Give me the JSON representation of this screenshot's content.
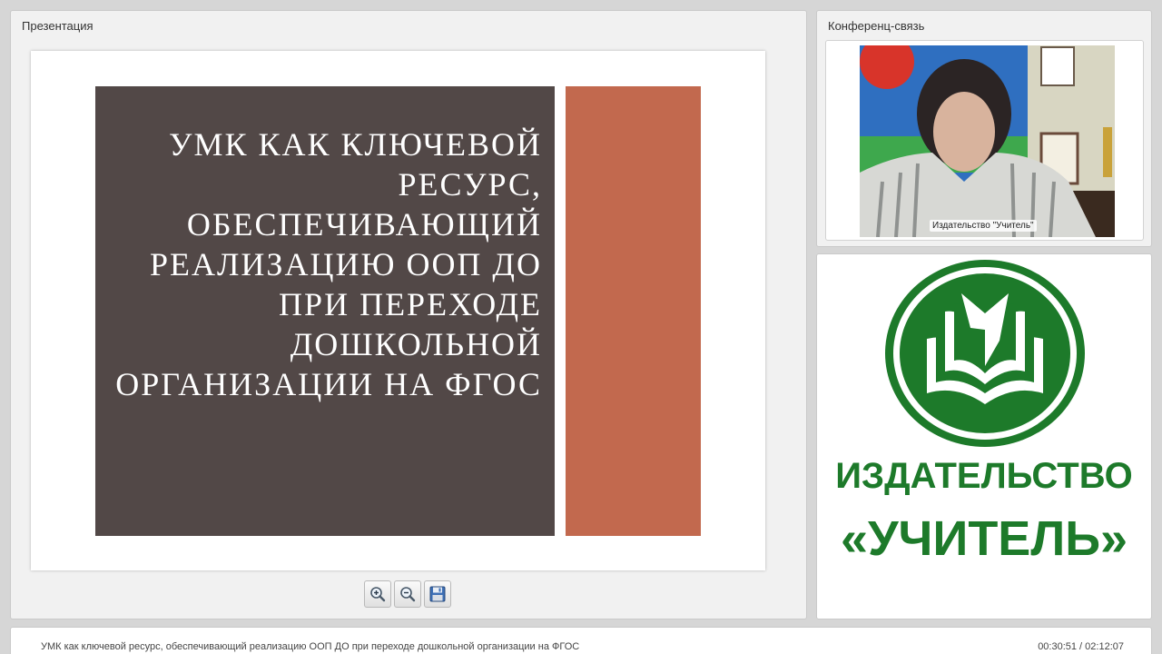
{
  "presentation": {
    "panel_title": "Презентация",
    "slide": {
      "title": "УМК КАК КЛЮЧЕВОЙ РЕСУРС, ОБЕСПЕЧИВАЮЩИЙ РЕАЛИЗАЦИЮ ООП ДО ПРИ ПЕРЕХОДЕ ДОШКОЛЬНОЙ ОРГАНИЗАЦИИ НА ФГОС",
      "dark_color": "#524847",
      "accent_color": "#c2694e"
    },
    "toolbar": {
      "zoom_in_icon": "zoom-in-icon",
      "zoom_out_icon": "zoom-out-icon",
      "save_icon": "save-icon"
    }
  },
  "conference": {
    "panel_title": "Конференц-связь",
    "video_caption": "Издательство \"Учитель\""
  },
  "logo": {
    "line1": "ИЗДАТЕЛЬСТВО",
    "line2": "«УЧИТЕЛЬ»",
    "brand_color": "#1d7a2a"
  },
  "status": {
    "title": "УМК как ключевой ресурс, обеспечивающий реализацию ООП ДО при переходе дошкольной организации на ФГОС",
    "time": "00:30:51 / 02:12:07"
  }
}
